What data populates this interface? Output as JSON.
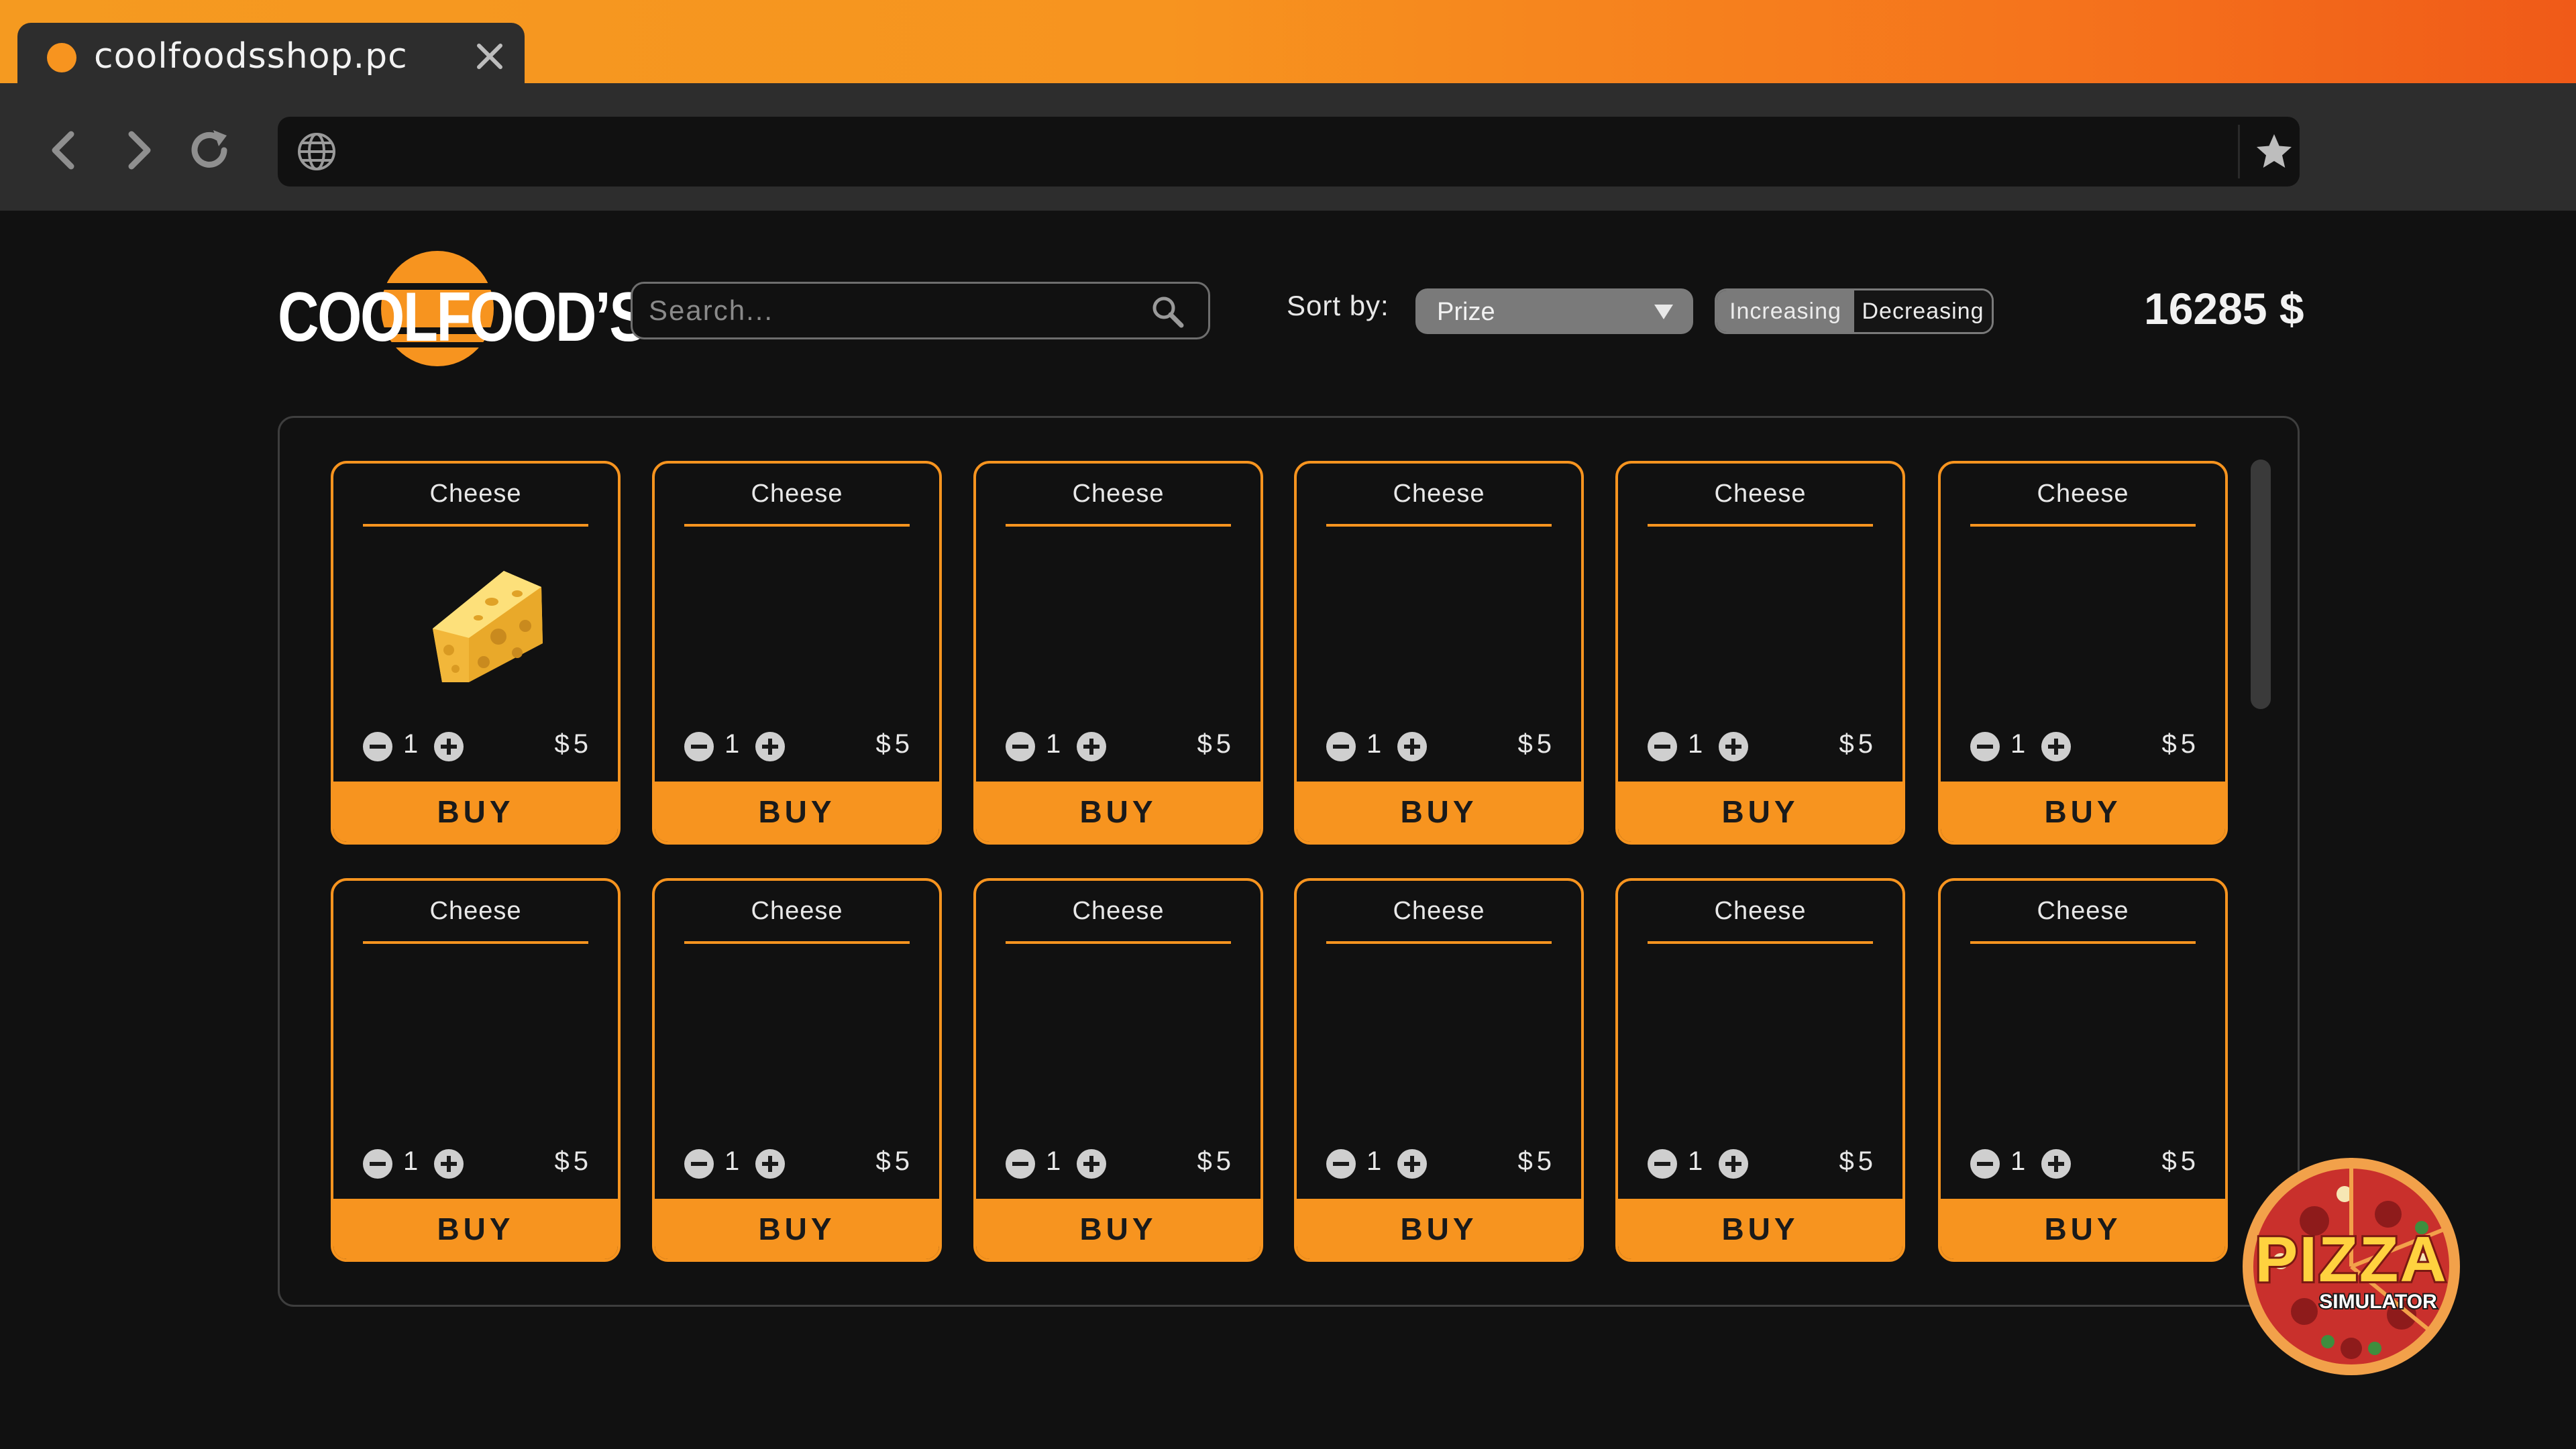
{
  "browser": {
    "tab_title": "coolfoodsshop.pc",
    "address": ""
  },
  "header": {
    "logo_text": "COOLFOOD’S",
    "search_placeholder": "Search...",
    "sort_label": "Sort by:",
    "sort_value": "Prize",
    "order_options": [
      "Increasing",
      "Decreasing"
    ],
    "order_selected": "Increasing",
    "balance": "16285 $"
  },
  "colors": {
    "accent": "#f7941f",
    "background": "#111111",
    "chrome": "#2d2d2d"
  },
  "products": [
    {
      "name": "Cheese",
      "qty": "1",
      "price": "$5",
      "buy_label": "BUY",
      "image": "cheese-wedge"
    },
    {
      "name": "Cheese",
      "qty": "1",
      "price": "$5",
      "buy_label": "BUY"
    },
    {
      "name": "Cheese",
      "qty": "1",
      "price": "$5",
      "buy_label": "BUY"
    },
    {
      "name": "Cheese",
      "qty": "1",
      "price": "$5",
      "buy_label": "BUY"
    },
    {
      "name": "Cheese",
      "qty": "1",
      "price": "$5",
      "buy_label": "BUY"
    },
    {
      "name": "Cheese",
      "qty": "1",
      "price": "$5",
      "buy_label": "BUY"
    },
    {
      "name": "Cheese",
      "qty": "1",
      "price": "$5",
      "buy_label": "BUY"
    },
    {
      "name": "Cheese",
      "qty": "1",
      "price": "$5",
      "buy_label": "BUY"
    },
    {
      "name": "Cheese",
      "qty": "1",
      "price": "$5",
      "buy_label": "BUY"
    },
    {
      "name": "Cheese",
      "qty": "1",
      "price": "$5",
      "buy_label": "BUY"
    },
    {
      "name": "Cheese",
      "qty": "1",
      "price": "$5",
      "buy_label": "BUY"
    },
    {
      "name": "Cheese",
      "qty": "1",
      "price": "$5",
      "buy_label": "BUY"
    }
  ],
  "watermark": {
    "logo_text": "PIZZA",
    "logo_subtext": "SIMULATOR"
  }
}
